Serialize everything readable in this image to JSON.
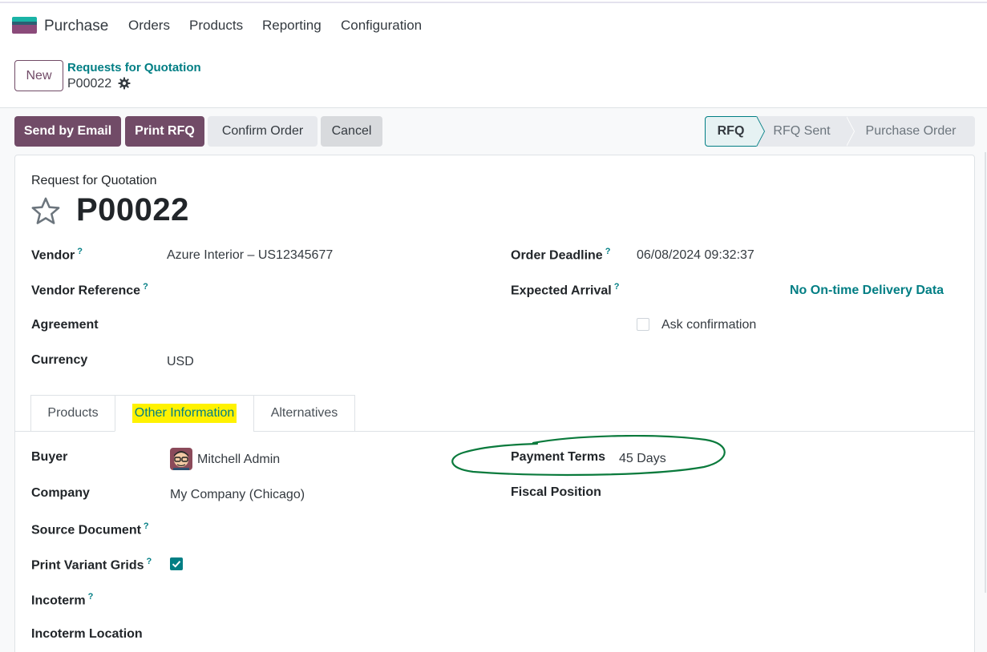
{
  "nav": {
    "app_name": "Purchase",
    "menu": [
      "Orders",
      "Products",
      "Reporting",
      "Configuration"
    ]
  },
  "control_panel": {
    "new_label": "New",
    "breadcrumb": "Requests for Quotation",
    "record_id": "P00022"
  },
  "actions": {
    "send_email": "Send by Email",
    "print_rfq": "Print RFQ",
    "confirm_order": "Confirm Order",
    "cancel": "Cancel"
  },
  "status_bar": {
    "stages": [
      "RFQ",
      "RFQ Sent",
      "Purchase Order"
    ],
    "current": "RFQ"
  },
  "form": {
    "title_small": "Request for Quotation",
    "title": "P00022",
    "vendor_label": "Vendor",
    "vendor_value": "Azure Interior – US12345677",
    "vendor_ref_label": "Vendor Reference",
    "agreement_label": "Agreement",
    "currency_label": "Currency",
    "currency_value": "USD",
    "order_deadline_label": "Order Deadline",
    "order_deadline_value": "06/08/2024 09:32:37",
    "expected_arrival_label": "Expected Arrival",
    "ontime_label": "No On-time Delivery Data",
    "ask_confirmation_label": "Ask confirmation",
    "help_mark": "?"
  },
  "tabs": {
    "products": "Products",
    "other_info": "Other Information",
    "alternatives": "Alternatives",
    "active": "Other Information"
  },
  "other_info": {
    "buyer_label": "Buyer",
    "buyer_value": "Mitchell Admin",
    "company_label": "Company",
    "company_value": "My Company (Chicago)",
    "source_doc_label": "Source Document",
    "print_variant_label": "Print Variant Grids",
    "print_variant_checked": true,
    "incoterm_label": "Incoterm",
    "incoterm_location_label": "Incoterm Location",
    "payment_terms_label": "Payment Terms",
    "payment_terms_value": "45 Days",
    "fiscal_position_label": "Fiscal Position"
  },
  "colors": {
    "primary": "#714b67",
    "accent": "#017e84",
    "highlight": "#fff200",
    "annotation": "#0a7a3c"
  },
  "icons": {
    "settings": "gear-icon",
    "favorite": "star-icon",
    "check": "check-icon"
  }
}
